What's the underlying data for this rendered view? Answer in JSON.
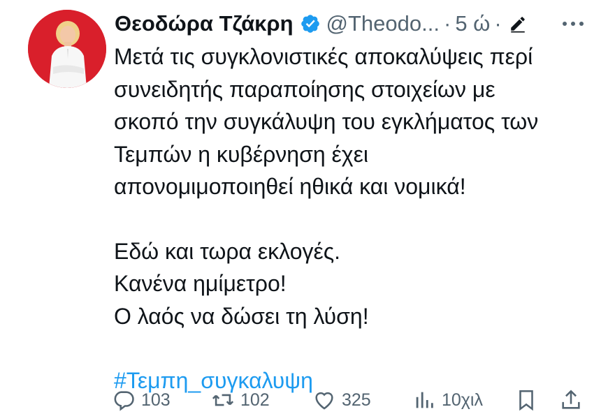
{
  "author": {
    "name": "Θεοδώρα Τζάκρη",
    "handle": "@Theodo...",
    "separator": "·",
    "time": "5 ώ",
    "separator2": "·"
  },
  "tweet": {
    "paragraph1": [
      "Μετά τις συγκλονιστικές αποκαλύψεις περί",
      "συνειδητής παραποίησης στοιχείων με",
      "σκοπό την συγκάλυψη του εγκλήματος των",
      "Τεμπών η κυβέρνηση έχει",
      "απονομιμοποιηθεί ηθικά και νομικά!"
    ],
    "paragraph2": [
      "Εδώ και τωρα εκλογές.",
      "Κανένα ημίμετρο!",
      "Ο λαός να δώσει τη λύση!"
    ],
    "hashtag": "#Τεμπη_συγκαλυψη"
  },
  "actions": {
    "replies": "103",
    "retweets": "102",
    "likes": "325",
    "views": "10χιλ"
  },
  "colors": {
    "accent": "#1d9bf0",
    "text": "#0f1419",
    "muted": "#536471",
    "avatar_bg": "#d91f2b"
  },
  "icons": [
    "verified-badge-icon",
    "pencil-icon",
    "more-icon",
    "reply-icon",
    "retweet-icon",
    "like-icon",
    "views-icon",
    "bookmark-icon",
    "share-icon"
  ]
}
